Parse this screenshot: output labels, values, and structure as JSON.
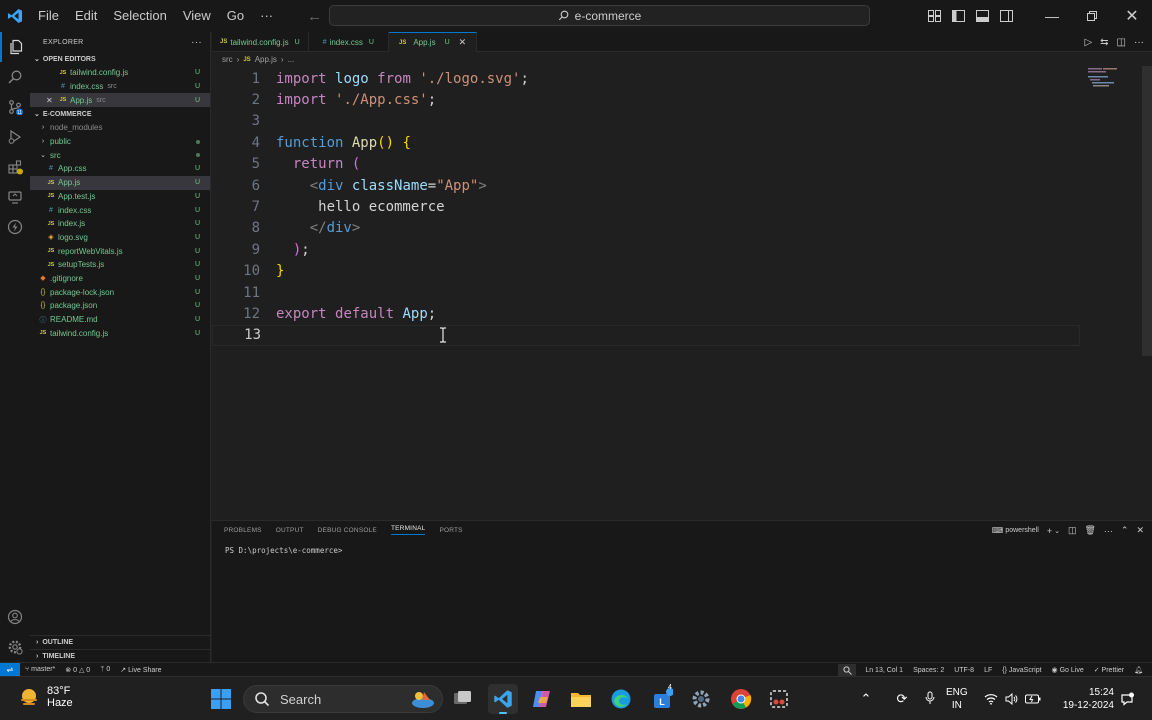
{
  "titlebar": {
    "menu": [
      "File",
      "Edit",
      "Selection",
      "View",
      "Go",
      "···"
    ],
    "command_center": "e-commerce"
  },
  "sidebar": {
    "title": "EXPLORER",
    "open_editors_label": "OPEN EDITORS",
    "open_editors": [
      {
        "name": "tailwind.config.js",
        "extra": "",
        "badge": "U",
        "icon": "js"
      },
      {
        "name": "index.css",
        "extra": "src",
        "badge": "U",
        "icon": "css"
      },
      {
        "name": "App.js",
        "extra": "src",
        "badge": "U",
        "icon": "js"
      }
    ],
    "project_label": "E-COMMERCE",
    "tree": [
      {
        "name": "node_modules",
        "type": "folder",
        "badge": ""
      },
      {
        "name": "public",
        "type": "folder",
        "badge": "•"
      },
      {
        "name": "src",
        "type": "folder-open",
        "badge": "•"
      },
      {
        "name": "App.css",
        "type": "css",
        "badge": "U"
      },
      {
        "name": "App.js",
        "type": "js",
        "badge": "U"
      },
      {
        "name": "App.test.js",
        "type": "js",
        "badge": "U"
      },
      {
        "name": "index.css",
        "type": "css",
        "badge": "U"
      },
      {
        "name": "index.js",
        "type": "js",
        "badge": "U"
      },
      {
        "name": "logo.svg",
        "type": "svg",
        "badge": "U"
      },
      {
        "name": "reportWebVitals.js",
        "type": "js",
        "badge": "U"
      },
      {
        "name": "setupTests.js",
        "type": "js",
        "badge": "U"
      },
      {
        "name": ".gitignore",
        "type": "git",
        "badge": "U"
      },
      {
        "name": "package-lock.json",
        "type": "json",
        "badge": "U"
      },
      {
        "name": "package.json",
        "type": "json",
        "badge": "U"
      },
      {
        "name": "README.md",
        "type": "md",
        "badge": "U"
      },
      {
        "name": "tailwind.config.js",
        "type": "js",
        "badge": "U"
      }
    ],
    "outline_label": "OUTLINE",
    "timeline_label": "TIMELINE"
  },
  "tabs": [
    {
      "icon": "JS",
      "name": "tailwind.config.js",
      "badge": "U"
    },
    {
      "icon": "#",
      "name": "index.css",
      "badge": "U"
    },
    {
      "icon": "JS",
      "name": "App.js",
      "badge": "U"
    }
  ],
  "breadcrumb": {
    "folder": "src",
    "icon": "JS",
    "file": "App.js",
    "more": "..."
  },
  "editor": {
    "line_numbers": [
      "1",
      "2",
      "3",
      "4",
      "5",
      "6",
      "7",
      "8",
      "9",
      "10",
      "11",
      "12",
      "13"
    ],
    "lines": [
      [
        [
          "kw",
          "import"
        ],
        [
          "pl",
          " "
        ],
        [
          "id",
          "logo"
        ],
        [
          "pl",
          " "
        ],
        [
          "kw",
          "from"
        ],
        [
          "pl",
          " "
        ],
        [
          "str",
          "'./logo.svg'"
        ],
        [
          "pl",
          ";"
        ]
      ],
      [
        [
          "kw",
          "import"
        ],
        [
          "pl",
          " "
        ],
        [
          "str",
          "'./App.css'"
        ],
        [
          "pl",
          ";"
        ]
      ],
      [],
      [
        [
          "kwb",
          "function"
        ],
        [
          "pl",
          " "
        ],
        [
          "fn",
          "App"
        ],
        [
          "br1",
          "()"
        ],
        [
          "pl",
          " "
        ],
        [
          "br1",
          "{"
        ]
      ],
      [
        [
          "pl",
          "  "
        ],
        [
          "kw",
          "return"
        ],
        [
          "pl",
          " "
        ],
        [
          "br2",
          "("
        ]
      ],
      [
        [
          "pl",
          "    "
        ],
        [
          "tagb",
          "<"
        ],
        [
          "tag",
          "div"
        ],
        [
          "pl",
          " "
        ],
        [
          "attr",
          "className"
        ],
        [
          "pl",
          "="
        ],
        [
          "str",
          "\"App\""
        ],
        [
          "tagb",
          ">"
        ]
      ],
      [
        [
          "pl",
          "     hello ecommerce"
        ]
      ],
      [
        [
          "pl",
          "    "
        ],
        [
          "tagb",
          "</"
        ],
        [
          "tag",
          "div"
        ],
        [
          "tagb",
          ">"
        ]
      ],
      [
        [
          "pl",
          "  "
        ],
        [
          "br2",
          ")"
        ],
        [
          "pl",
          ";"
        ]
      ],
      [
        [
          "br1",
          "}"
        ]
      ],
      [],
      [
        [
          "kw",
          "export"
        ],
        [
          "pl",
          " "
        ],
        [
          "kw",
          "default"
        ],
        [
          "pl",
          " "
        ],
        [
          "id",
          "App"
        ],
        [
          "pl",
          ";"
        ]
      ],
      []
    ]
  },
  "panel": {
    "tabs": [
      "PROBLEMS",
      "OUTPUT",
      "DEBUG CONSOLE",
      "TERMINAL",
      "PORTS"
    ],
    "shell": "powershell",
    "prompt": "PS D:\\projects\\e-commerce>"
  },
  "statusbar": {
    "branch": "master*",
    "errors": "0",
    "warnings": "0",
    "ports": "0",
    "live_share": "Live Share",
    "position": "Ln 13, Col 1",
    "spaces": "Spaces: 2",
    "encoding": "UTF-8",
    "eol": "LF",
    "language": "JavaScript",
    "go_live": "Go Live",
    "prettier": "Prettier"
  },
  "taskbar": {
    "temperature": "83°F",
    "weather": "Haze",
    "search_placeholder": "Search",
    "lang_top": "ENG",
    "lang_bottom": "IN",
    "time": "15:24",
    "date": "19-12-2024",
    "store_badge": "4"
  }
}
